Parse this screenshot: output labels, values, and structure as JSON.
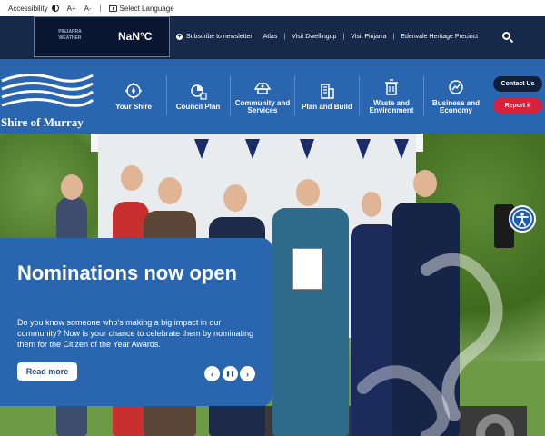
{
  "accessibility_bar": {
    "label": "Accessibility",
    "font_increase": "A+",
    "font_decrease": "A-",
    "language": "Select Language"
  },
  "weather": {
    "logo_text": "PINJARRA WEATHER",
    "temperature": "NaN°C"
  },
  "top_links": {
    "newsletter": "Subscribe to newsletter",
    "items": [
      "Atlas",
      "Visit Dwellingup",
      "Visit Pinjarra",
      "Edenvale Heritage Precinct"
    ]
  },
  "logo": {
    "text": "Shire of Murray"
  },
  "nav": {
    "items": [
      {
        "label": "Your Shire",
        "icon": "compass-icon"
      },
      {
        "label": "Council Plan",
        "icon": "pie-chart-icon"
      },
      {
        "label": "Community and Services",
        "icon": "community-icon"
      },
      {
        "label": "Plan and Build",
        "icon": "building-icon"
      },
      {
        "label": "Waste and Environment",
        "icon": "bin-icon"
      },
      {
        "label": "Business and Economy",
        "icon": "chart-icon"
      }
    ],
    "contact": "Contact Us",
    "report": "Report it"
  },
  "hero": {
    "title": "Nominations now open",
    "body": "Do you know someone who's making a big impact in our community? Now is your chance to celebrate them by nominating them for the Citizen of the Year Awards.",
    "button": "Read more",
    "prev": "‹",
    "pause": "❚❚",
    "next": "›"
  },
  "colors": {
    "navy": "#16294a",
    "primary_blue": "#2a66b0",
    "report_red": "#d8213b"
  }
}
